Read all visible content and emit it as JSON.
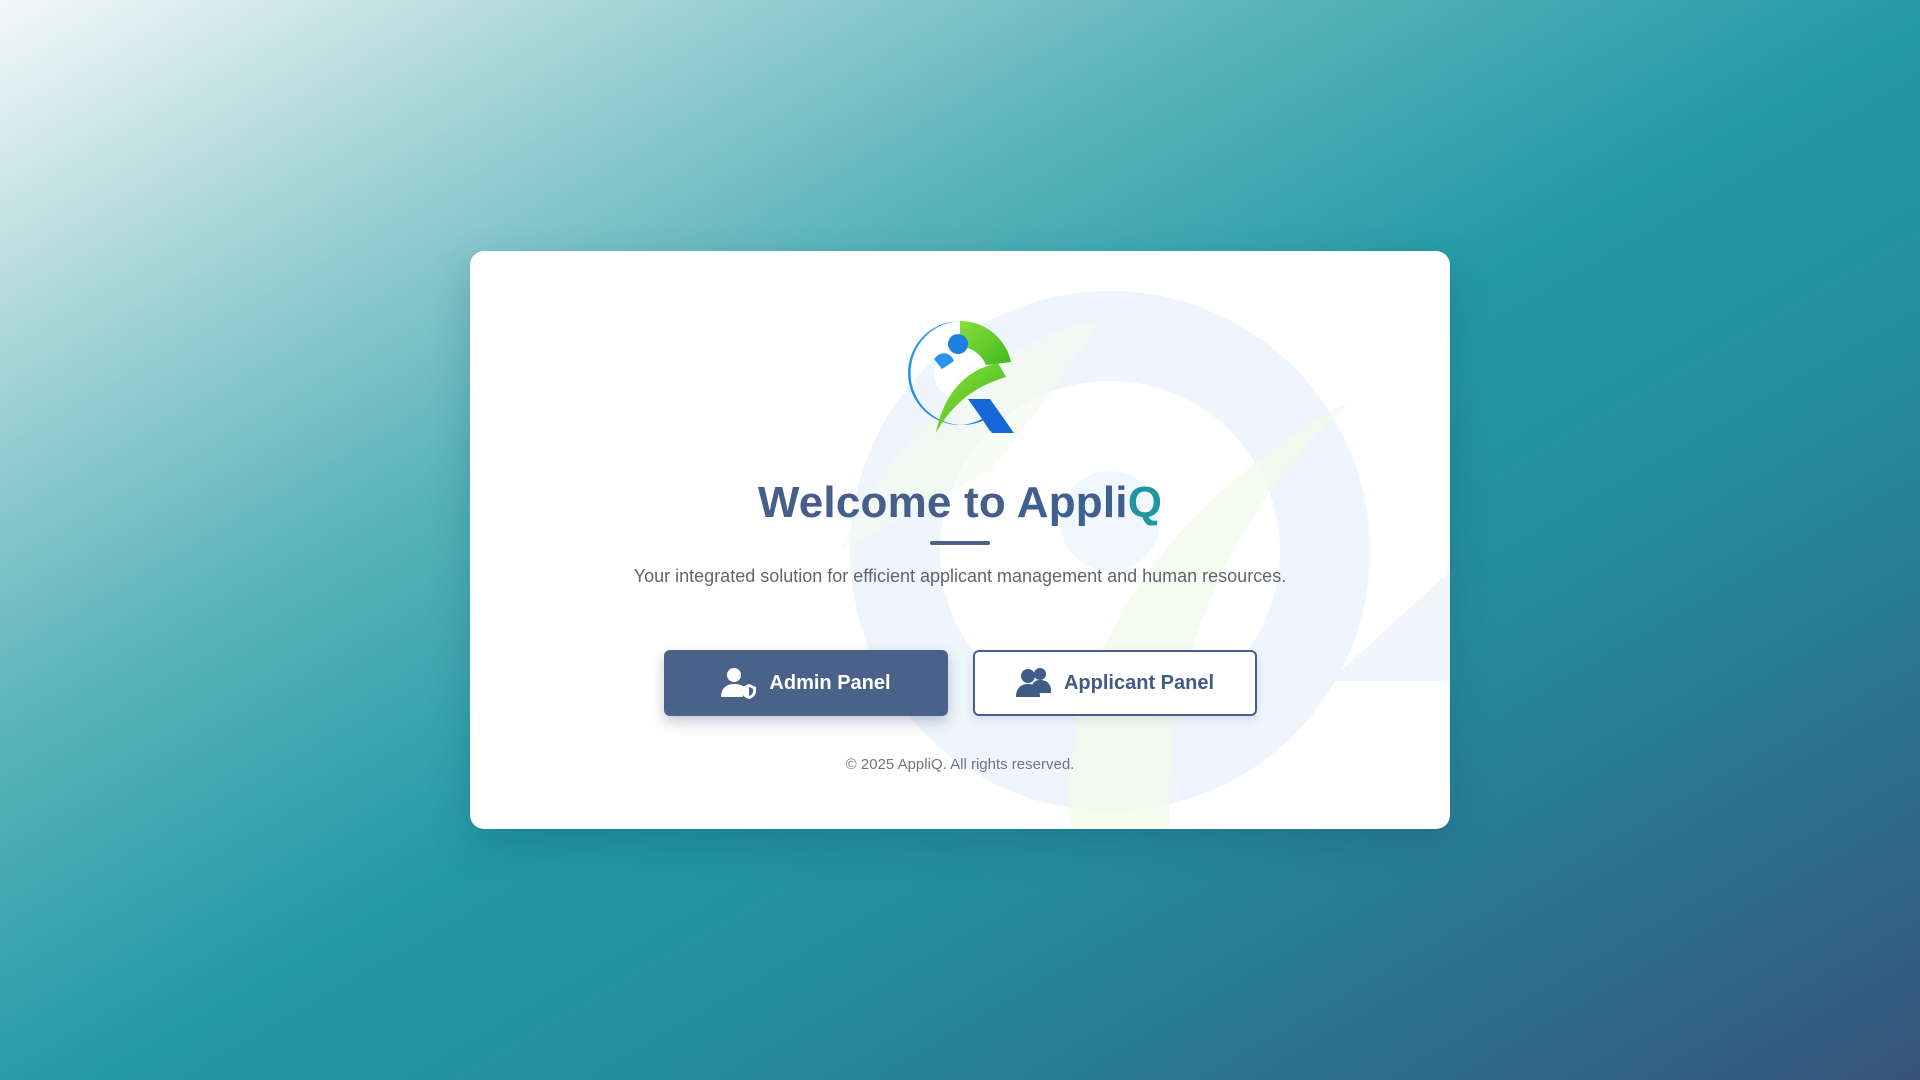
{
  "app": {
    "brand_name": "AppliQ",
    "logo_icon": "appliq-logo-icon"
  },
  "hero": {
    "title_prefix": "Welcome to ",
    "title_brand_part1": "Appli",
    "title_brand_part2": "Q",
    "subtitle": "Your integrated solution for efficient applicant management and human resources."
  },
  "actions": {
    "admin": {
      "label": "Admin Panel",
      "icon": "user-shield-icon"
    },
    "applicant": {
      "label": "Applicant Panel",
      "icon": "users-icon"
    }
  },
  "footer": {
    "copyright": "© 2025 AppliQ. All rights reserved."
  },
  "colors": {
    "primary": "#4a6189",
    "accent_teal": "#1f95a2",
    "logo_blue": "#1e88e5",
    "logo_green": "#5fcf1e"
  }
}
